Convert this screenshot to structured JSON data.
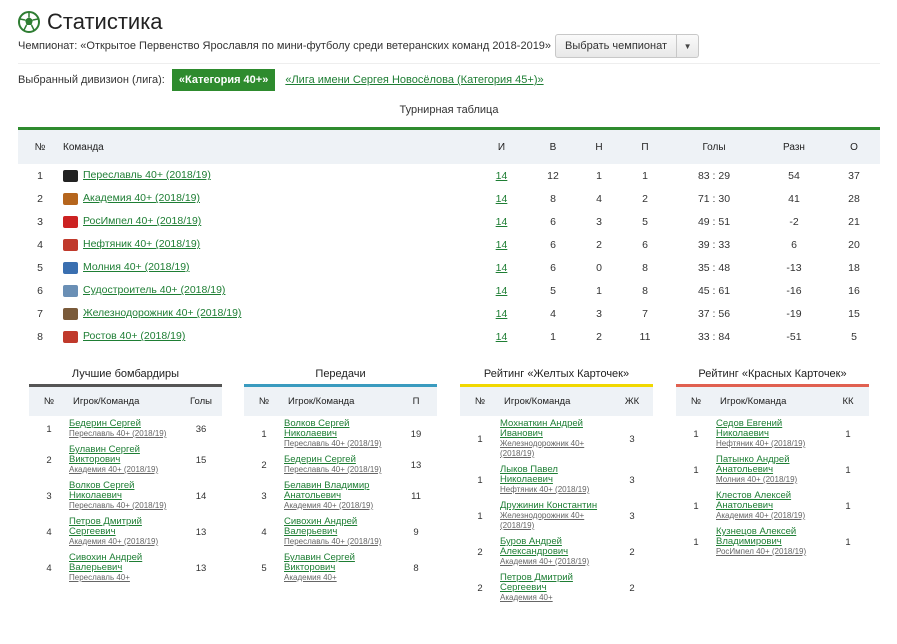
{
  "header": {
    "title": "Статистика",
    "championship_label": "Чемпионат:",
    "championship_name": "«Открытое Первенство Ярославля по мини-футболу среди ветеранских команд 2018-2019»",
    "select_button": "Выбрать чемпионат",
    "caret": "▼"
  },
  "division": {
    "label": "Выбранный дивизион (лига):",
    "active": "«Категория 40+»",
    "other": "«Лига имени Сергея Новосёлова (Категория 45+)»"
  },
  "standings": {
    "title": "Турнирная таблица",
    "columns": [
      "№",
      "Команда",
      "И",
      "В",
      "Н",
      "П",
      "Голы",
      "Разн",
      "О"
    ],
    "rows": [
      {
        "n": "1",
        "team": "Переславль 40+ (2018/19)",
        "logo_color": "#222222",
        "g": "14",
        "w": "12",
        "d": "1",
        "l": "1",
        "goals": "83 : 29",
        "diff": "54",
        "pts": "37"
      },
      {
        "n": "2",
        "team": "Академия 40+ (2018/19)",
        "logo_color": "#b5651d",
        "g": "14",
        "w": "8",
        "d": "4",
        "l": "2",
        "goals": "71 : 30",
        "diff": "41",
        "pts": "28"
      },
      {
        "n": "3",
        "team": "РосИмпел 40+ (2018/19)",
        "logo_color": "#cc2222",
        "g": "14",
        "w": "6",
        "d": "3",
        "l": "5",
        "goals": "49 : 51",
        "diff": "-2",
        "pts": "21"
      },
      {
        "n": "4",
        "team": "Нефтяник 40+ (2018/19)",
        "logo_color": "#c0392b",
        "g": "14",
        "w": "6",
        "d": "2",
        "l": "6",
        "goals": "39 : 33",
        "diff": "6",
        "pts": "20"
      },
      {
        "n": "5",
        "team": "Молния 40+ (2018/19)",
        "logo_color": "#3a6fb0",
        "g": "14",
        "w": "6",
        "d": "0",
        "l": "8",
        "goals": "35 : 48",
        "diff": "-13",
        "pts": "18"
      },
      {
        "n": "6",
        "team": "Судостроитель 40+ (2018/19)",
        "logo_color": "#6a8fb5",
        "g": "14",
        "w": "5",
        "d": "1",
        "l": "8",
        "goals": "45 : 61",
        "diff": "-16",
        "pts": "16"
      },
      {
        "n": "7",
        "team": "Железнодорожник 40+ (2018/19)",
        "logo_color": "#7a5a3a",
        "g": "14",
        "w": "4",
        "d": "3",
        "l": "7",
        "goals": "37 : 56",
        "diff": "-19",
        "pts": "15"
      },
      {
        "n": "8",
        "team": "Ростов 40+ (2018/19)",
        "logo_color": "#c0392b",
        "g": "14",
        "w": "1",
        "d": "2",
        "l": "11",
        "goals": "33 : 84",
        "diff": "-51",
        "pts": "5"
      }
    ]
  },
  "panels": [
    {
      "title": "Лучшие бомбардиры",
      "bar_color": "#555555",
      "columns": [
        "№",
        "Игрок/Команда",
        "Голы"
      ],
      "rows": [
        {
          "n": "1",
          "name": "Бедерин Сергей",
          "team": "Переславль 40+ (2018/19)",
          "val": "36"
        },
        {
          "n": "2",
          "name": "Булавин Сергей Викторович",
          "team": "Академия 40+ (2018/19)",
          "val": "15"
        },
        {
          "n": "3",
          "name": "Волков Сергей Николаевич",
          "team": "Переславль 40+ (2018/19)",
          "val": "14"
        },
        {
          "n": "4",
          "name": "Петров Дмитрий Сергеевич",
          "team": "Академия 40+ (2018/19)",
          "val": "13"
        },
        {
          "n": "4",
          "name": "Сивохин Андрей Валерьевич",
          "team": "Переславль 40+",
          "val": "13"
        }
      ]
    },
    {
      "title": "Передачи",
      "bar_color": "#3a9bbf",
      "columns": [
        "№",
        "Игрок/Команда",
        "П"
      ],
      "rows": [
        {
          "n": "1",
          "name": "Волков Сергей Николаевич",
          "team": "Переславль 40+ (2018/19)",
          "val": "19"
        },
        {
          "n": "2",
          "name": "Бедерин Сергей",
          "team": "Переславль 40+ (2018/19)",
          "val": "13"
        },
        {
          "n": "3",
          "name": "Белавин Владимир Анатольевич",
          "team": "Академия 40+ (2018/19)",
          "val": "11"
        },
        {
          "n": "4",
          "name": "Сивохин Андрей Валерьевич",
          "team": "Переславль 40+ (2018/19)",
          "val": "9"
        },
        {
          "n": "5",
          "name": "Булавин Сергей Викторович",
          "team": "Академия 40+",
          "val": "8"
        }
      ]
    },
    {
      "title": "Рейтинг «Желтых Карточек»",
      "bar_color": "#f1d800",
      "columns": [
        "№",
        "Игрок/Команда",
        "ЖК"
      ],
      "rows": [
        {
          "n": "1",
          "name": "Мохнаткин Андрей Иванович",
          "team": "Железнодорожник 40+ (2018/19)",
          "val": "3"
        },
        {
          "n": "1",
          "name": "Лыков Павел Николаевич",
          "team": "Нефтяник 40+ (2018/19)",
          "val": "3"
        },
        {
          "n": "1",
          "name": "Дружинин Константин",
          "team": "Железнодорожник 40+ (2018/19)",
          "val": "3"
        },
        {
          "n": "2",
          "name": "Буров Андрей Александрович",
          "team": "Академия 40+ (2018/19)",
          "val": "2"
        },
        {
          "n": "2",
          "name": "Петров Дмитрий Сергеевич",
          "team": "Академия 40+",
          "val": "2"
        }
      ]
    },
    {
      "title": "Рейтинг «Красных Карточек»",
      "bar_color": "#e06050",
      "columns": [
        "№",
        "Игрок/Команда",
        "КК"
      ],
      "rows": [
        {
          "n": "1",
          "name": "Седов Евгений Николаевич",
          "team": "Нефтяник 40+ (2018/19)",
          "val": "1"
        },
        {
          "n": "1",
          "name": "Патынко Андрей Анатольевич",
          "team": "Молния 40+ (2018/19)",
          "val": "1"
        },
        {
          "n": "1",
          "name": "Клестов Алексей Анатольевич",
          "team": "Академия 40+ (2018/19)",
          "val": "1"
        },
        {
          "n": "1",
          "name": "Кузнецов Алексей Владимирович",
          "team": "РосИмпел 40+ (2018/19)",
          "val": "1"
        }
      ]
    }
  ]
}
